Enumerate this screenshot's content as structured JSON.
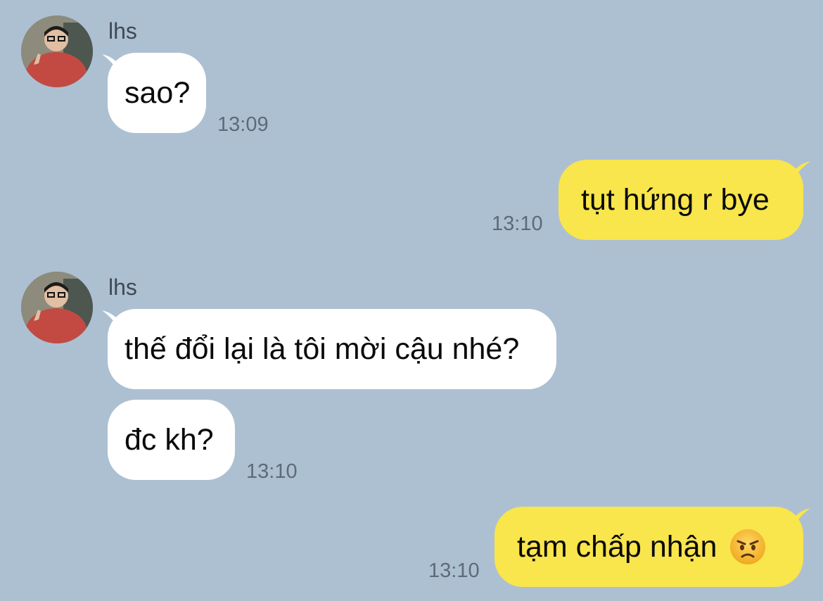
{
  "colors": {
    "background": "#adc0d2",
    "incoming_bubble": "#ffffff",
    "outgoing_bubble": "#f9e54c",
    "timestamp": "#5d6b79"
  },
  "messages": [
    {
      "sender": "lhs",
      "text": "sao?",
      "time": "13:09",
      "direction": "incoming"
    },
    {
      "text": "tụt hứng r bye",
      "time": "13:10",
      "direction": "outgoing"
    },
    {
      "sender": "lhs",
      "text": "thế đổi lại là tôi mời cậu nhé?",
      "direction": "incoming"
    },
    {
      "text": "đc kh?",
      "time": "13:10",
      "direction": "incoming"
    },
    {
      "text": "tạm chấp nhận",
      "emoji": "angry-face-emoji",
      "time": "13:10",
      "direction": "outgoing"
    }
  ]
}
